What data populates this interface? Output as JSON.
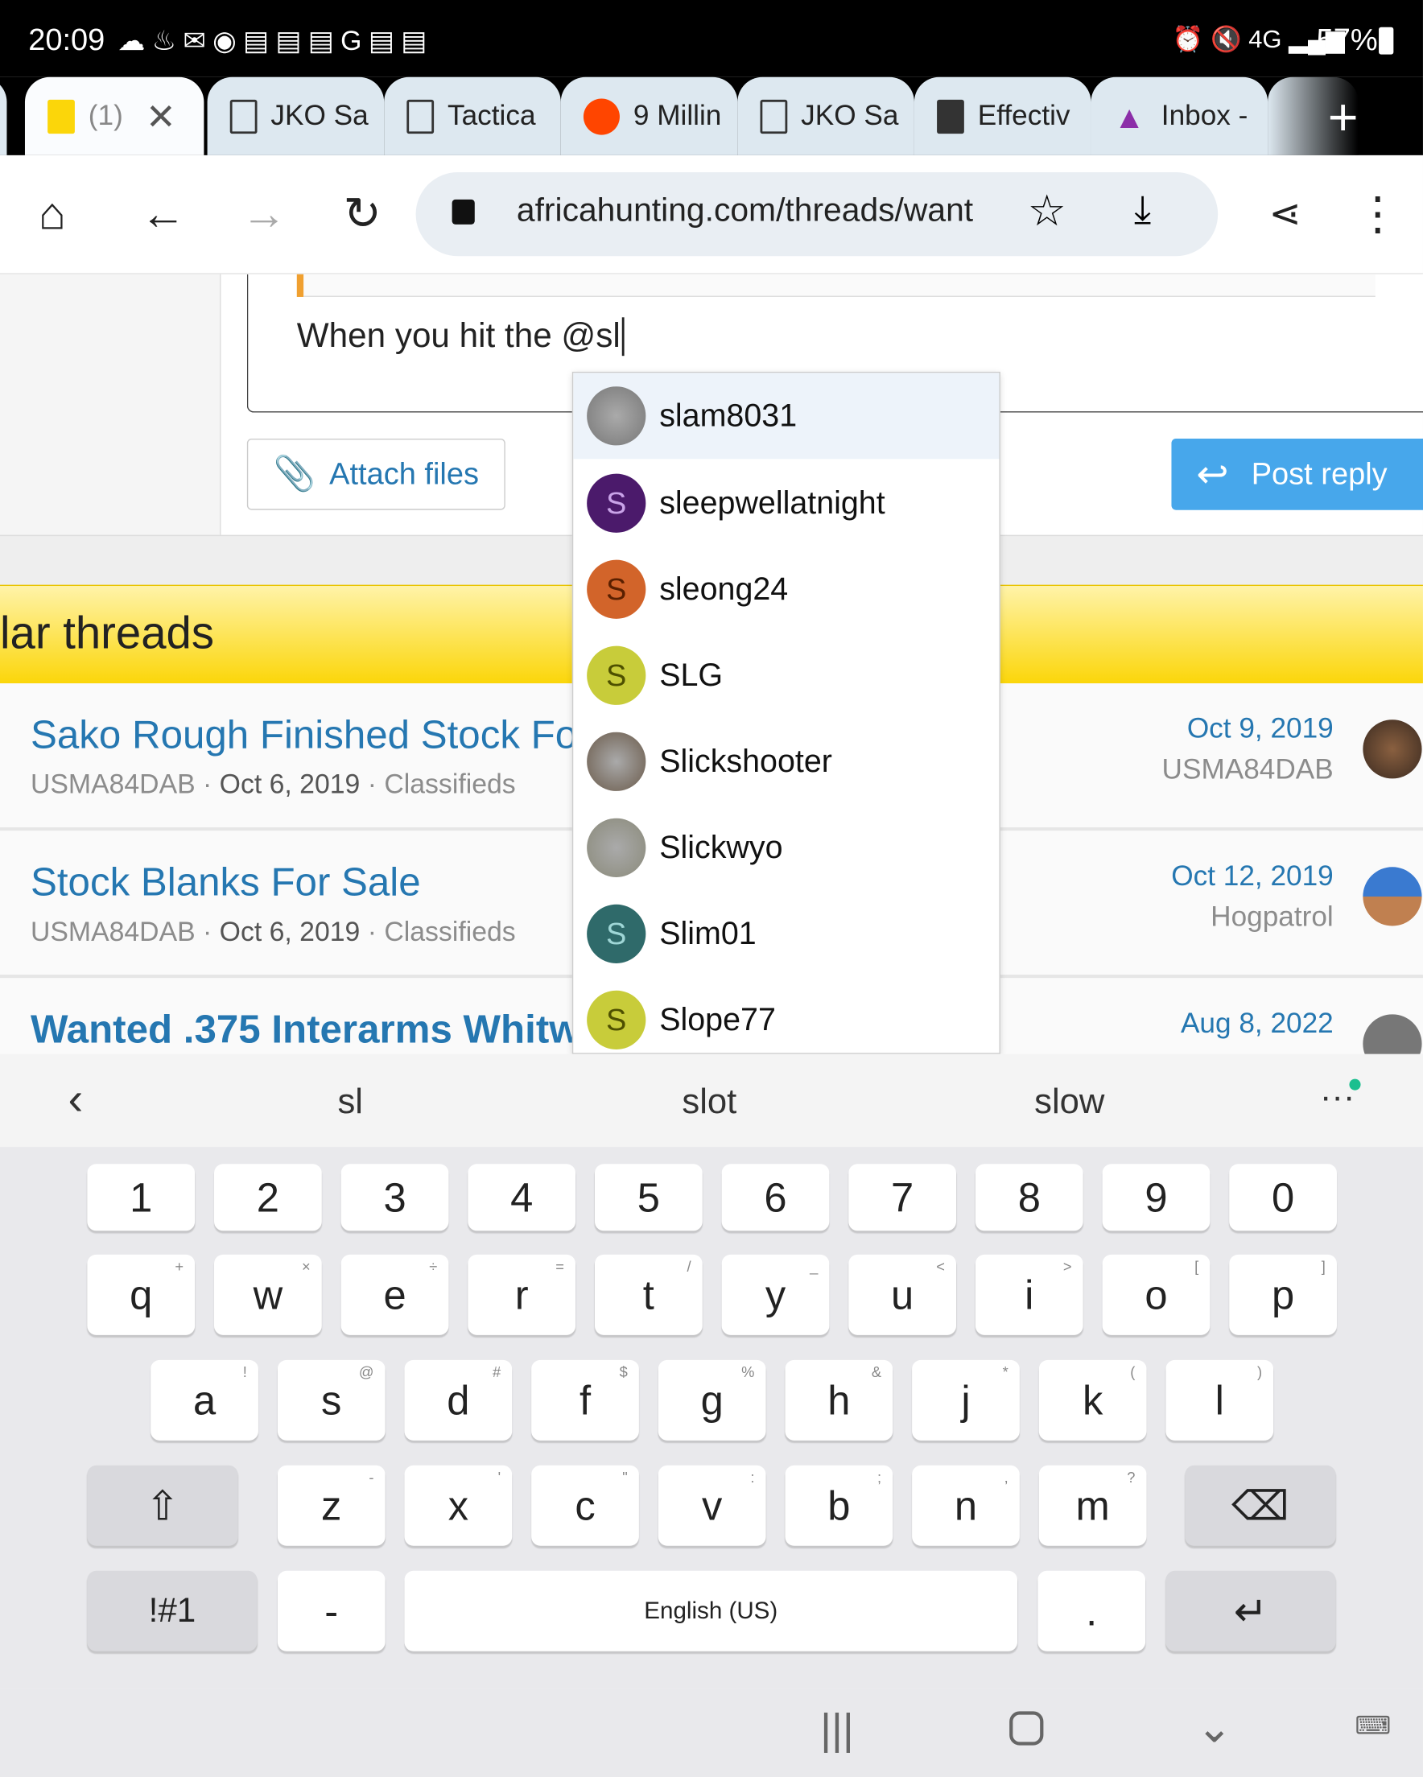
{
  "status_bar": {
    "time": "20:09",
    "battery": "57%",
    "network": "4G"
  },
  "tabs": [
    {
      "title": "(1)",
      "icon": "africahunting-favicon",
      "active": true
    },
    {
      "title": "JKO Sa",
      "icon": "page-icon"
    },
    {
      "title": "Tactica",
      "icon": "page-icon"
    },
    {
      "title": "9 Millin",
      "icon": "reddit-icon"
    },
    {
      "title": "JKO Sa",
      "icon": "page-icon"
    },
    {
      "title": "Effectiv",
      "icon": "site-favicon"
    },
    {
      "title": "Inbox -",
      "icon": "proton-icon"
    }
  ],
  "toolbar": {
    "url": "africahunting.com/threads/want"
  },
  "editor": {
    "text": "When you hit the @sl"
  },
  "buttons": {
    "attach": "Attach files",
    "post_reply": "Post reply"
  },
  "colors": {
    "accent": "#2577b1",
    "post_reply_bg": "#47a7eb",
    "header_yellow": "#fbd60a"
  },
  "mention_dropdown": {
    "query": "sl",
    "items": [
      {
        "name": "slam8031",
        "avatar": "photo",
        "bg": "#777"
      },
      {
        "name": "sleepwellatnight",
        "avatar": "S",
        "bg": "#4b1a6b",
        "fg": "#c9a3e8"
      },
      {
        "name": "sleong24",
        "avatar": "S",
        "bg": "#d2642a",
        "fg": "#5a2000"
      },
      {
        "name": "SLG",
        "avatar": "S",
        "bg": "#c8cc3a",
        "fg": "#4e5000"
      },
      {
        "name": "Slickshooter",
        "avatar": "photo",
        "bg": "#6a5a4a"
      },
      {
        "name": "Slickwyo",
        "avatar": "photo",
        "bg": "#8a8a7a"
      },
      {
        "name": "Slim01",
        "avatar": "S",
        "bg": "#2f6a6a",
        "fg": "#9fd6d6"
      },
      {
        "name": "Slope77",
        "avatar": "S",
        "bg": "#c8cc3a",
        "fg": "#4e5000"
      }
    ]
  },
  "similar_threads": {
    "heading": "lar threads",
    "rows": [
      {
        "title": "Sako Rough Finished Stock Fo",
        "author": "USMA84DAB",
        "date": "Oct 6, 2019",
        "forum": "Classifieds",
        "last_date": "Oct 9, 2019",
        "last_user": "USMA84DAB",
        "bold": false
      },
      {
        "title": "Stock Blanks For Sale",
        "author": "USMA84DAB",
        "date": "Oct 6, 2019",
        "forum": "Classifieds",
        "last_date": "Oct 12, 2019",
        "last_user": "Hogpatrol",
        "bold": false
      },
      {
        "title": "Wanted .375 Interarms Whitw",
        "last_date": "Aug 8, 2022",
        "bold": true
      }
    ]
  },
  "keyboard": {
    "suggestions": [
      "sl",
      "slot",
      "slow"
    ],
    "numbers": [
      "1",
      "2",
      "3",
      "4",
      "5",
      "6",
      "7",
      "8",
      "9",
      "0"
    ],
    "row1": [
      [
        "q",
        "+"
      ],
      [
        "w",
        "×"
      ],
      [
        "e",
        "÷"
      ],
      [
        "r",
        "="
      ],
      [
        "t",
        "/"
      ],
      [
        "y",
        "_"
      ],
      [
        "u",
        "<"
      ],
      [
        "i",
        ">"
      ],
      [
        "o",
        "["
      ],
      [
        "p",
        "]"
      ]
    ],
    "row2": [
      [
        "a",
        "!"
      ],
      [
        "s",
        "@"
      ],
      [
        "d",
        "#"
      ],
      [
        "f",
        "$"
      ],
      [
        "g",
        "%"
      ],
      [
        "h",
        "&"
      ],
      [
        "j",
        "*"
      ],
      [
        "k",
        "("
      ],
      [
        "l",
        ")"
      ]
    ],
    "row3": [
      [
        "z",
        "-"
      ],
      [
        "x",
        "'"
      ],
      [
        "c",
        "\""
      ],
      [
        "v",
        ":"
      ],
      [
        "b",
        ";"
      ],
      [
        "n",
        ","
      ],
      [
        "m",
        "?"
      ]
    ],
    "symbols": "!#1",
    "dash": "-",
    "space": "English (US)",
    "period": "."
  }
}
